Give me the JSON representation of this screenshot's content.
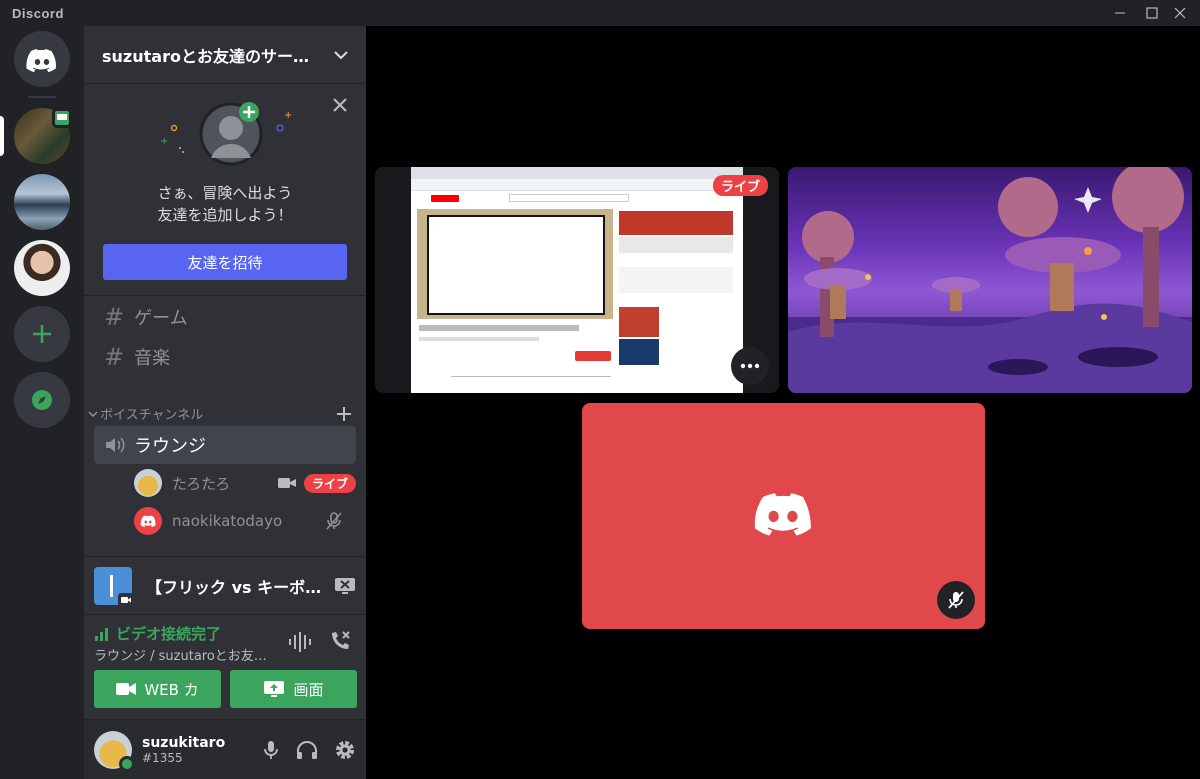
{
  "window": {
    "app_title": "Discord",
    "controls": [
      "minimize",
      "maximize",
      "close"
    ]
  },
  "guilds": [
    {
      "name": "home",
      "icon": "discord-logo-icon"
    },
    {
      "name": "server-1",
      "icon": "server-avatar",
      "badge_icon": "screen-share-icon"
    },
    {
      "name": "server-2",
      "icon": "server-avatar"
    },
    {
      "name": "server-3",
      "icon": "server-avatar"
    },
    {
      "name": "add-server",
      "icon": "plus-icon"
    },
    {
      "name": "explore",
      "icon": "compass-icon"
    }
  ],
  "server": {
    "name": "suzutaroとお友達のサー…",
    "dropdown_icon": "chevron-down-icon"
  },
  "invite": {
    "line1": "さぁ、冒険へ出よう",
    "line2": "友達を追加しよう！",
    "button": "友達を招待"
  },
  "text_channels": [
    {
      "name": "ゲーム"
    },
    {
      "name": "音楽"
    }
  ],
  "voice_category": {
    "label": "ボイスチャンネル"
  },
  "voice_channel": {
    "name": "ラウンジ",
    "users": [
      {
        "name": "たろたろ",
        "live": "ライブ",
        "icon": "camera-icon"
      },
      {
        "name": "naokikatodayo",
        "icon": "mic-muted-icon"
      }
    ]
  },
  "activity": {
    "title": "【フリック vs キーボ…"
  },
  "rtc": {
    "status": "ビデオ接続完了",
    "channel": "ラウンジ / suzutaroとお友…",
    "video_button": "WEB カ",
    "screen_button": "画面"
  },
  "user": {
    "name": "suzukitaro",
    "tag": "#1355"
  },
  "stage": {
    "live_badge": "ライブ",
    "more_icon": "more-horizontal-icon",
    "muted_icon": "mic-muted-icon"
  },
  "colors": {
    "blurple": "#5865f2",
    "green": "#3ba55d",
    "red": "#ed4245",
    "tile_red": "#e0484b"
  }
}
